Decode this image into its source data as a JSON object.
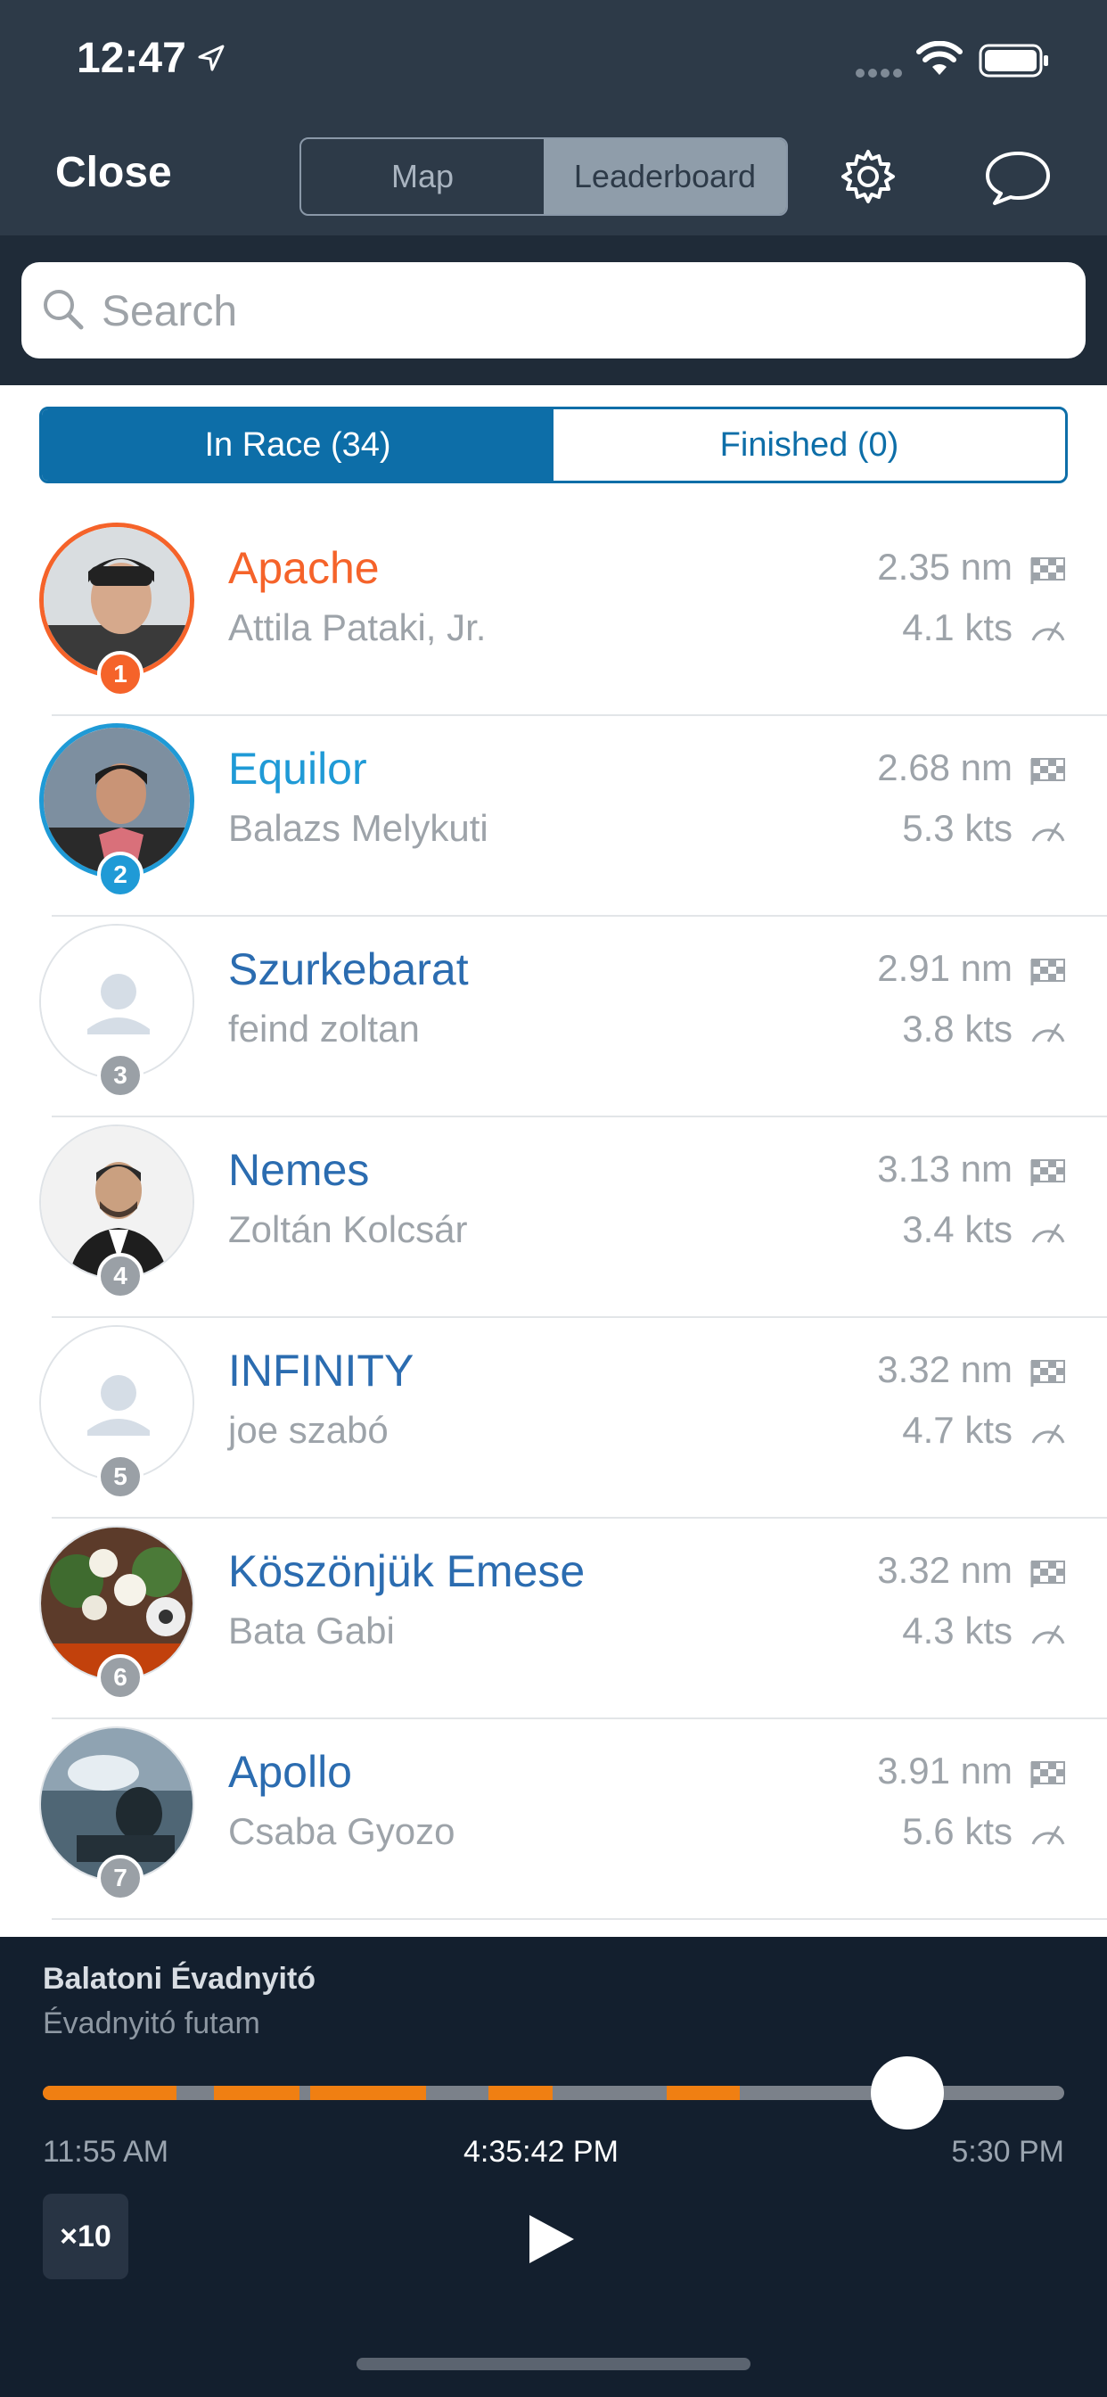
{
  "status": {
    "time": "12:47"
  },
  "header": {
    "close_label": "Close",
    "tabs": [
      "Map",
      "Leaderboard"
    ],
    "active_tab": "Leaderboard"
  },
  "search": {
    "placeholder": "Search"
  },
  "race_tabs": {
    "in_race": "In Race (34)",
    "finished": "Finished (0)"
  },
  "colors": {
    "leader": "#f5632a",
    "second": "#1f9ad6",
    "default_name": "#2b6cb0",
    "tab_active": "#0d6ea8"
  },
  "entries": [
    {
      "rank": "1",
      "boat": "Apache",
      "skipper": "Attila Pataki, Jr.",
      "distance": "2.35 nm",
      "speed": "4.1 kts"
    },
    {
      "rank": "2",
      "boat": "Equilor",
      "skipper": "Balazs Melykuti",
      "distance": "2.68 nm",
      "speed": "5.3 kts"
    },
    {
      "rank": "3",
      "boat": "Szurkebarat",
      "skipper": "feind zoltan",
      "distance": "2.91 nm",
      "speed": "3.8 kts"
    },
    {
      "rank": "4",
      "boat": "Nemes",
      "skipper": "Zoltán  Kolcsár",
      "distance": "3.13 nm",
      "speed": "3.4 kts"
    },
    {
      "rank": "5",
      "boat": "INFINITY",
      "skipper": "joe szabó",
      "distance": "3.32 nm",
      "speed": "4.7 kts"
    },
    {
      "rank": "6",
      "boat": "Köszönjük Emese",
      "skipper": "Bata Gabi",
      "distance": "3.32 nm",
      "speed": "4.3 kts"
    },
    {
      "rank": "7",
      "boat": "Apollo",
      "skipper": "Csaba Gyozo",
      "distance": "3.91 nm",
      "speed": "5.6 kts"
    }
  ],
  "player": {
    "race_name": "Balatoni Évadnyitó",
    "race_subtitle": "Évadnyitó futam",
    "start_time": "11:55 AM",
    "current_time": "4:35:42 PM",
    "end_time": "5:30 PM",
    "speed_multiplier": "×10",
    "progress": 0.846
  }
}
